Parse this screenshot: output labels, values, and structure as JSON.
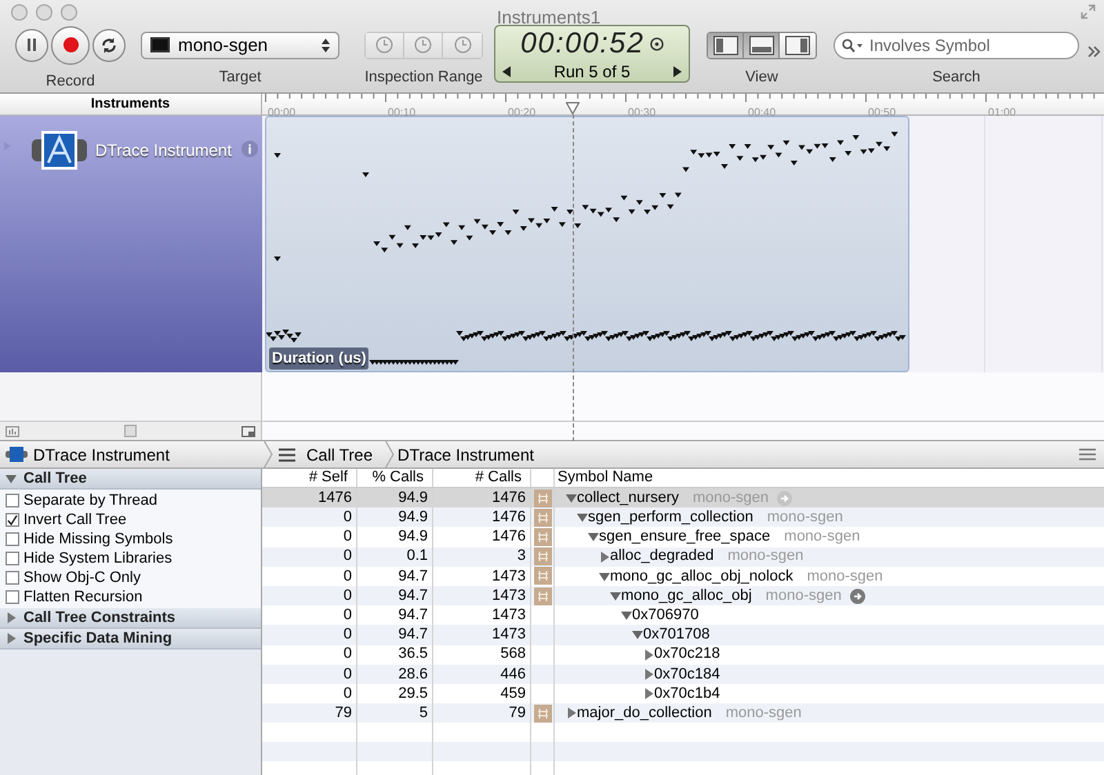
{
  "window": {
    "title": "Instruments1"
  },
  "toolbar": {
    "record": {
      "label": "Record"
    },
    "target": {
      "value": "mono-sgen",
      "label": "Target"
    },
    "inspection_range": {
      "label": "Inspection Range",
      "disabled": true
    },
    "timer": {
      "time": "00:00:52",
      "run": "Run 5 of 5"
    },
    "view": {
      "label": "View",
      "buttons": [
        {
          "kind": "left",
          "selected": true
        },
        {
          "kind": "bottom",
          "selected": true
        },
        {
          "kind": "right",
          "selected": false
        }
      ]
    },
    "search": {
      "placeholder": "Involves Symbol",
      "label": "Search"
    }
  },
  "timeline": {
    "header": "Instruments",
    "ticks": [
      "00:00",
      "00:10",
      "00:20",
      "00:30",
      "00:40",
      "00:50",
      "01:00"
    ],
    "instrument": {
      "name": "DTrace Instrument",
      "graph_label": "Duration (us)"
    }
  },
  "detail_bar": {
    "instrument": "DTrace Instrument",
    "breadcrumbs": [
      "Call Tree",
      "DTrace Instrument"
    ]
  },
  "sidebar": {
    "sections": [
      {
        "title": "Call Tree",
        "expanded": true,
        "options": [
          {
            "label": "Separate by Thread",
            "checked": false
          },
          {
            "label": "Invert Call Tree",
            "checked": true
          },
          {
            "label": "Hide Missing Symbols",
            "checked": false
          },
          {
            "label": "Hide System Libraries",
            "checked": false
          },
          {
            "label": "Show Obj-C Only",
            "checked": false
          },
          {
            "label": "Flatten Recursion",
            "checked": false
          }
        ]
      },
      {
        "title": "Call Tree Constraints",
        "expanded": false
      },
      {
        "title": "Specific Data Mining",
        "expanded": false
      }
    ]
  },
  "table": {
    "columns": [
      "# Self",
      "% Calls",
      "# Calls",
      "Symbol Name"
    ],
    "rows": [
      {
        "self": "1476",
        "pct": "94.9",
        "calls": "1476",
        "symbol": "collect_nursery",
        "library": "mono-sgen",
        "user_code": true,
        "focus": true,
        "selected": true,
        "expanded": true,
        "children": [
          {
            "self": "0",
            "pct": "94.9",
            "calls": "1476",
            "symbol": "sgen_perform_collection",
            "library": "mono-sgen",
            "user_code": true,
            "focus": false,
            "selected": false,
            "expanded": true,
            "children": [
              {
                "self": "0",
                "pct": "94.9",
                "calls": "1476",
                "symbol": "sgen_ensure_free_space",
                "library": "mono-sgen",
                "user_code": true,
                "focus": false,
                "selected": false,
                "expanded": true,
                "children": [
                  {
                    "self": "0",
                    "pct": "0.1",
                    "calls": "3",
                    "symbol": "alloc_degraded",
                    "library": "mono-sgen",
                    "user_code": true,
                    "focus": false,
                    "selected": false,
                    "expanded": false
                  },
                  {
                    "self": "0",
                    "pct": "94.7",
                    "calls": "1473",
                    "symbol": "mono_gc_alloc_obj_nolock",
                    "library": "mono-sgen",
                    "user_code": true,
                    "focus": false,
                    "selected": false,
                    "expanded": true,
                    "children": [
                      {
                        "self": "0",
                        "pct": "94.7",
                        "calls": "1473",
                        "symbol": "mono_gc_alloc_obj",
                        "library": "mono-sgen",
                        "user_code": true,
                        "focus": true,
                        "selected": false,
                        "expanded": true,
                        "children": [
                          {
                            "self": "0",
                            "pct": "94.7",
                            "calls": "1473",
                            "symbol": "0x706970",
                            "user_code": false,
                            "focus": false,
                            "selected": false,
                            "expanded": true,
                            "children": [
                              {
                                "self": "0",
                                "pct": "94.7",
                                "calls": "1473",
                                "symbol": "0x701708",
                                "user_code": false,
                                "focus": false,
                                "selected": false,
                                "expanded": true,
                                "children": [
                                  {
                                    "self": "0",
                                    "pct": "36.5",
                                    "calls": "568",
                                    "symbol": "0x70c218",
                                    "user_code": false,
                                    "focus": false,
                                    "selected": false,
                                    "expanded": false
                                  },
                                  {
                                    "self": "0",
                                    "pct": "28.6",
                                    "calls": "446",
                                    "symbol": "0x70c184",
                                    "user_code": false,
                                    "focus": false,
                                    "selected": false,
                                    "expanded": false
                                  },
                                  {
                                    "self": "0",
                                    "pct": "29.5",
                                    "calls": "459",
                                    "symbol": "0x70c1b4",
                                    "user_code": false,
                                    "focus": false,
                                    "selected": false,
                                    "expanded": false
                                  }
                                ]
                              }
                            ]
                          }
                        ]
                      }
                    ]
                  }
                ]
              }
            ]
          }
        ]
      },
      {
        "self": "79",
        "pct": "5",
        "calls": "79",
        "symbol": "major_do_collection",
        "library": "mono-sgen",
        "user_code": true,
        "focus": false,
        "selected": false,
        "expanded": false
      }
    ]
  }
}
